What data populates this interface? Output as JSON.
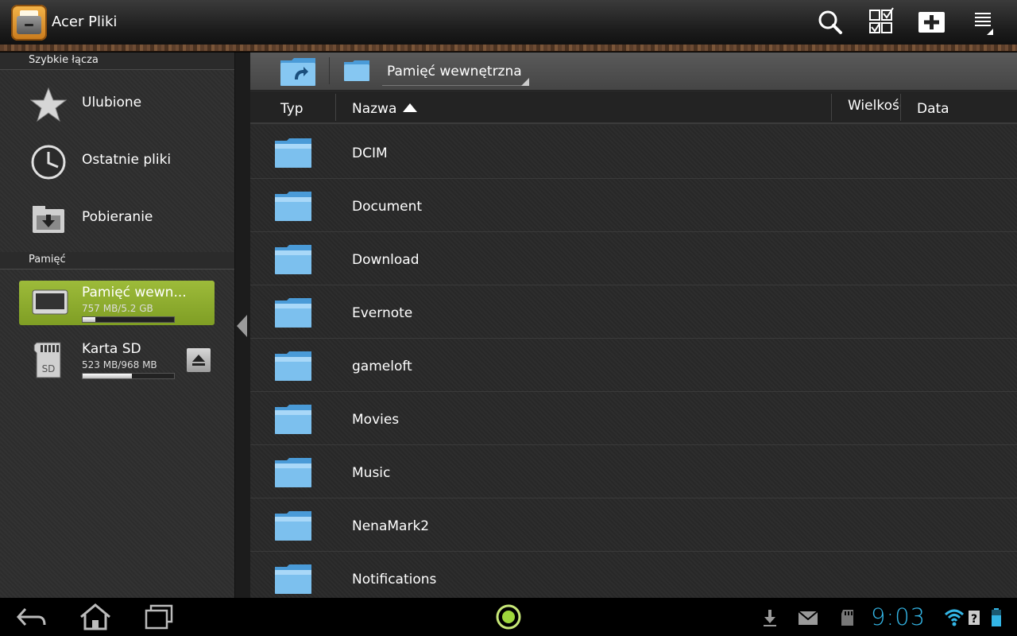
{
  "app": {
    "title": "Acer Pliki"
  },
  "actionbar": {
    "icons": [
      "search-icon",
      "multi-select-icon",
      "new-folder-icon",
      "overflow-menu-icon"
    ]
  },
  "sidebar": {
    "quick_links_header": "Szybkie łącza",
    "quick_links": [
      {
        "label": "Ulubione",
        "icon": "star-icon"
      },
      {
        "label": "Ostatnie pliki",
        "icon": "clock-icon"
      },
      {
        "label": "Pobieranie",
        "icon": "download-folder-icon"
      }
    ],
    "storage_header": "Pamięć",
    "storage": [
      {
        "name": "Pamięć wewn...",
        "size": "757 MB/5.2 GB",
        "used_fraction": 0.14,
        "selected": true,
        "icon": "tablet-storage-icon"
      },
      {
        "name": "Karta SD",
        "size": "523 MB/968 MB",
        "used_fraction": 0.54,
        "selected": false,
        "icon": "sd-card-icon",
        "badge": "SD"
      }
    ]
  },
  "path": {
    "current": "Pamięć wewnętrzna"
  },
  "columns": {
    "type": "Typ",
    "name": "Nazwa",
    "size": "Wielkość",
    "date": "Data"
  },
  "files": [
    {
      "name": "DCIM"
    },
    {
      "name": "Document"
    },
    {
      "name": "Download"
    },
    {
      "name": "Evernote"
    },
    {
      "name": "gameloft"
    },
    {
      "name": "Movies"
    },
    {
      "name": "Music"
    },
    {
      "name": "NenaMark2"
    },
    {
      "name": "Notifications"
    }
  ],
  "statusbar": {
    "clock": "9:03"
  },
  "colors": {
    "accent_green": "#8cac2e",
    "clock_blue": "#33b5e5",
    "folder_blue": "#7cc0ee"
  }
}
